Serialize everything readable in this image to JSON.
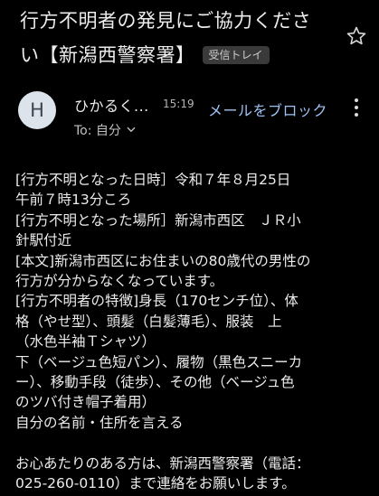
{
  "email": {
    "subject": "行方不明者の発見にご協力ください【新潟西警察署】",
    "label": "受信トレイ",
    "sender_initial": "H",
    "sender_name": "ひかるく...",
    "time": "15:19",
    "to": "To: 自分",
    "block_action": "メールをブロック",
    "body_lines": [
      "[行方不明となった日時］令和７年８月25日",
      "午前７時13分ころ",
      "[行方不明となった場所］新潟市西区　ＪＲ小",
      "針駅付近",
      "[本文]新潟市西区にお住まいの80歳代の男性の",
      "行方が分からなくなっています。",
      "[行方不明者の特徴]身長（170センチ位）、体",
      "格（やせ型）、頭髪（白髪薄毛）、服装　上",
      "（水色半袖Ｔシャツ）",
      "下（ベージュ色短パン）、履物（黒色スニーカ",
      "ー）、移動手段（徒歩）、その他（ベージュ色",
      "のツバ付き帽子着用）",
      "自分の名前・住所を言える",
      "",
      "お心あたりのある方は、新潟西警察署（電話：",
      "025-260-0110）まで連絡をお願いします。"
    ]
  },
  "icons": {
    "star": "star-outline-icon",
    "menu": "more-vert-icon",
    "expand": "chevron-down-icon"
  },
  "colors": {
    "background": "#000000",
    "text": "#ececec",
    "link": "#9fc2f4",
    "badge_bg": "#3a3a3a",
    "avatar_bg": "#dde3ea"
  }
}
